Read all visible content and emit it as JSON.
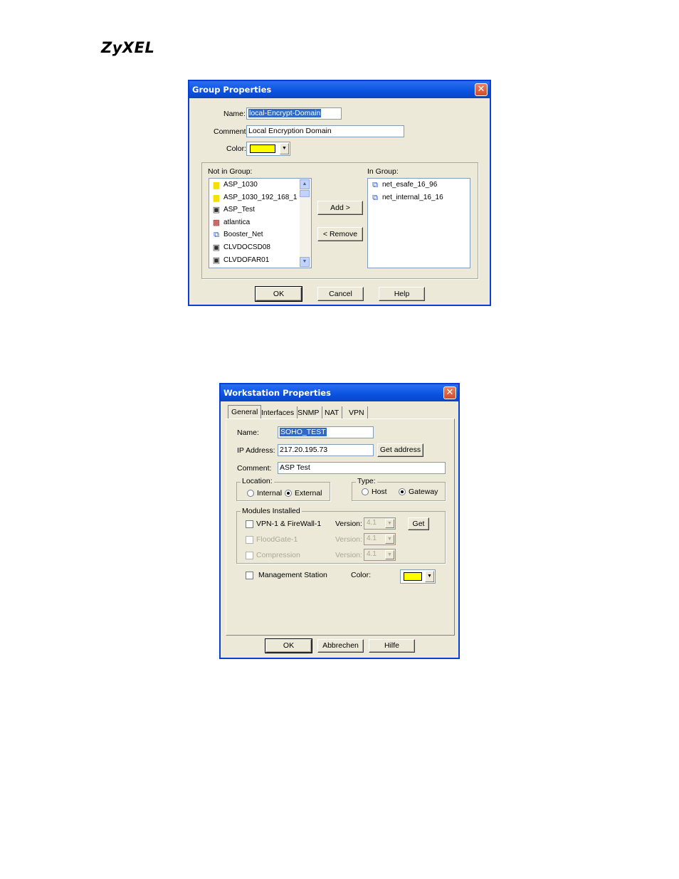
{
  "brand": "ZyXEL",
  "group_dialog": {
    "title": "Group Properties",
    "name_label": "Name:",
    "name_value": "local-Encrypt-Domain",
    "comment_label": "Comment:",
    "comment_value": "Local Encryption Domain",
    "color_label": "Color:",
    "color_value": "#ffff00",
    "not_in_group_label": "Not in Group:",
    "in_group_label": "In Group:",
    "not_in_group_items": [
      {
        "label": "ASP_1030",
        "icon": "yellow-network-icon"
      },
      {
        "label": "ASP_1030_192_168_1",
        "icon": "yellow-network-icon"
      },
      {
        "label": "ASP_Test",
        "icon": "workstation-icon"
      },
      {
        "label": "atlantica",
        "icon": "gateway-icon"
      },
      {
        "label": "Booster_Net",
        "icon": "network-icon"
      },
      {
        "label": "CLVDOCSD08",
        "icon": "workstation-icon"
      },
      {
        "label": "CLVDOFAR01",
        "icon": "workstation-icon"
      }
    ],
    "in_group_items": [
      {
        "label": "net_esafe_16_96",
        "icon": "network-icon"
      },
      {
        "label": "net_internal_16_16",
        "icon": "network-icon"
      }
    ],
    "add_button": "Add  >",
    "remove_button": "<  Remove",
    "ok_button": "OK",
    "cancel_button": "Cancel",
    "help_button": "Help"
  },
  "workstation_dialog": {
    "title": "Workstation Properties",
    "tabs": [
      "General",
      "Interfaces",
      "SNMP",
      "NAT",
      "VPN"
    ],
    "active_tab": "General",
    "name_label": "Name:",
    "name_value": "SOHO_TEST",
    "ip_label": "IP Address:",
    "ip_value": "217.20.195.73",
    "get_address_button": "Get address",
    "comment_label": "Comment:",
    "comment_value": "ASP Test",
    "location": {
      "title": "Location:",
      "options": [
        "Internal",
        "External"
      ],
      "selected": "External"
    },
    "type": {
      "title": "Type:",
      "options": [
        "Host",
        "Gateway"
      ],
      "selected": "Gateway"
    },
    "modules": {
      "title": "Modules Installed",
      "items": [
        {
          "label": "VPN-1 & FireWall-1",
          "version_label": "Version:",
          "version": "4.1",
          "enabled": true,
          "checked": false
        },
        {
          "label": "FloodGate-1",
          "version_label": "Version:",
          "version": "4.1",
          "enabled": false,
          "checked": false
        },
        {
          "label": "Compression",
          "version_label": "Version:",
          "version": "4.1",
          "enabled": false,
          "checked": false
        }
      ],
      "get_button": "Get"
    },
    "management_station_label": "Management Station",
    "management_station_checked": false,
    "color_label": "Color:",
    "color_value": "#ffff00",
    "ok_button": "OK",
    "cancel_button": "Abbrechen",
    "help_button": "Hilfe"
  }
}
